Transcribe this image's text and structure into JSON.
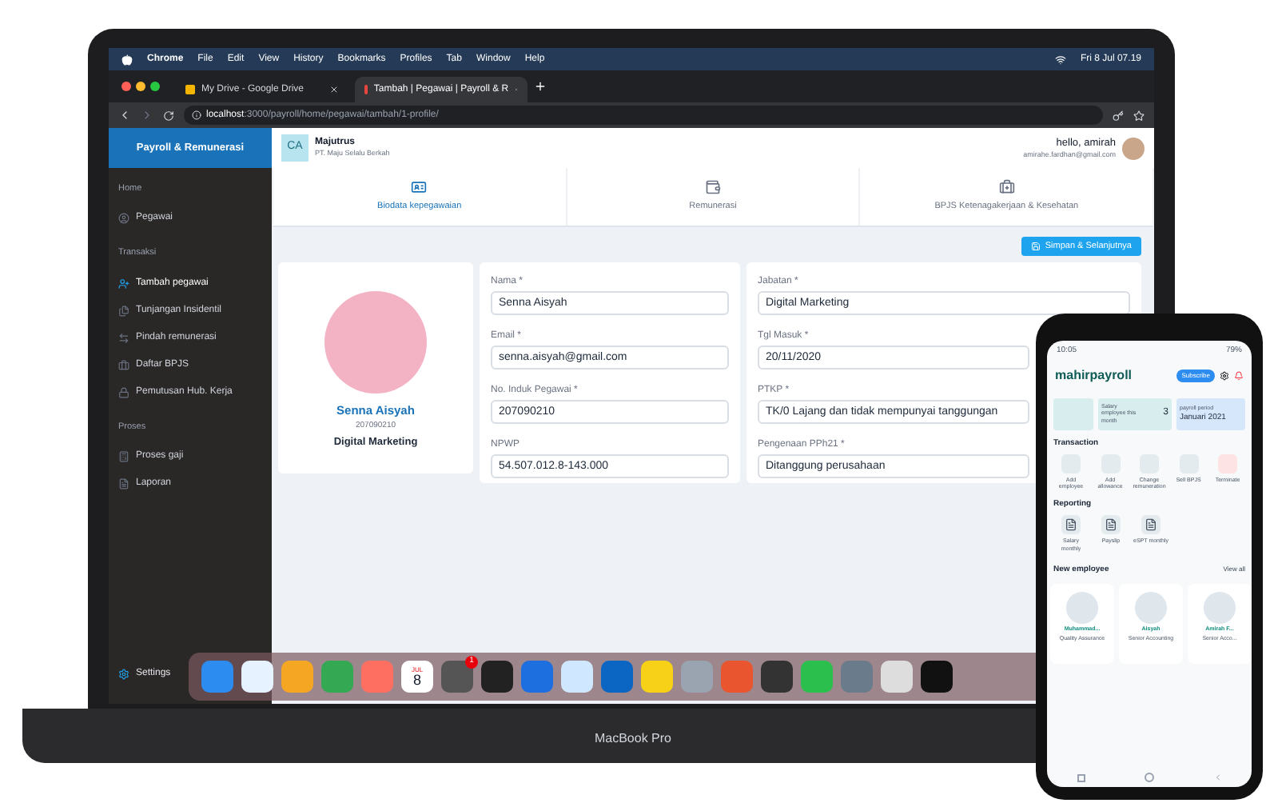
{
  "menubar": {
    "items": [
      "Chrome",
      "File",
      "Edit",
      "View",
      "History",
      "Bookmarks",
      "Profiles",
      "Tab",
      "Window",
      "Help"
    ],
    "clock": "Fri 8 Jul  07.19"
  },
  "browser": {
    "tabs": [
      {
        "title": "My Drive - Google Drive",
        "selected": false
      },
      {
        "title": "Tambah | Pegawai | Payroll & R",
        "selected": true
      }
    ],
    "url_host": "localhost",
    "url_path": ":3000/payroll/home/pegawai/tambah/1-profile/"
  },
  "sidebar": {
    "title": "Payroll & Remunerasi",
    "sections": [
      {
        "heading": "Home",
        "items": [
          {
            "label": "Pegawai",
            "selected": false
          }
        ]
      },
      {
        "heading": "Transaksi",
        "items": [
          {
            "label": "Tambah pegawai",
            "selected": true
          },
          {
            "label": "Tunjangan Insidentil",
            "selected": false
          },
          {
            "label": "Pindah remunerasi",
            "selected": false
          },
          {
            "label": "Daftar BPJS",
            "selected": false
          },
          {
            "label": "Pemutusan Hub. Kerja",
            "selected": false
          }
        ]
      },
      {
        "heading": "Proses",
        "items": [
          {
            "label": "Proses gaji",
            "selected": false
          },
          {
            "label": "Laporan",
            "selected": false
          }
        ]
      }
    ],
    "settings": "Settings"
  },
  "header": {
    "initials": "CA",
    "company": "Majutrus",
    "company_full": "PT. Maju Selalu Berkah",
    "greeting": "hello, amirah",
    "email": "amirahe.fardhan@gmail.com"
  },
  "steps": [
    {
      "label": "Biodata kepegawaian",
      "selected": true
    },
    {
      "label": "Remunerasi",
      "selected": false
    },
    {
      "label": "BPJS Ketenagakerjaan & Kesehatan",
      "selected": false
    }
  ],
  "save_button": "Simpan & Selanjutnya",
  "profile": {
    "name": "Senna Aisyah",
    "id": "207090210",
    "position": "Digital Marketing"
  },
  "form_columns": [
    [
      {
        "label": "Nama *",
        "value": "Senna Aisyah"
      },
      {
        "label": "Email *",
        "value": "senna.aisyah@gmail.com"
      },
      {
        "label": "No. Induk Pegawai *",
        "value": "207090210"
      },
      {
        "label": "NPWP",
        "value": "54.507.012.8-143.000"
      }
    ],
    [
      {
        "label": "Jabatan *",
        "value": "Digital Marketing"
      },
      {
        "label": "Tgl Masuk *",
        "value": "20/11/2020"
      },
      {
        "label": "PTKP *",
        "value": "TK/0 Lajang dan tidak mempunyai tanggungan"
      },
      {
        "label": "Pengenaan PPh21 *",
        "value": "Ditanggung perusahaan"
      }
    ]
  ],
  "dock": {
    "calendar_month": "JUL",
    "calendar_day": "8",
    "badge": "1"
  },
  "device_label": "MacBook Pro",
  "phone": {
    "time": "10:05",
    "battery": "79%",
    "app_name": "mahirpayroll",
    "subscribe": "Subscribe",
    "stat_label": "Salary employee this month",
    "stat_value": "3",
    "period_label": "payroll period",
    "period_value": "Januari 2021",
    "transaction_title": "Transaction",
    "transactions": [
      "Add employee",
      "Add allowance",
      "Change remuneration",
      "Sell BPJS",
      "Terminate"
    ],
    "reporting_title": "Reporting",
    "reports": [
      "Salary monthly",
      "Payslip",
      "eSPT monthly"
    ],
    "new_title": "New employee",
    "view_all": "View all",
    "employees": [
      {
        "name": "Muhammad...",
        "role": "Quality Assurance"
      },
      {
        "name": "Aisyah",
        "role": "Senior Accounting"
      },
      {
        "name": "Amirah F...",
        "role": "Senior Acco..."
      }
    ]
  }
}
